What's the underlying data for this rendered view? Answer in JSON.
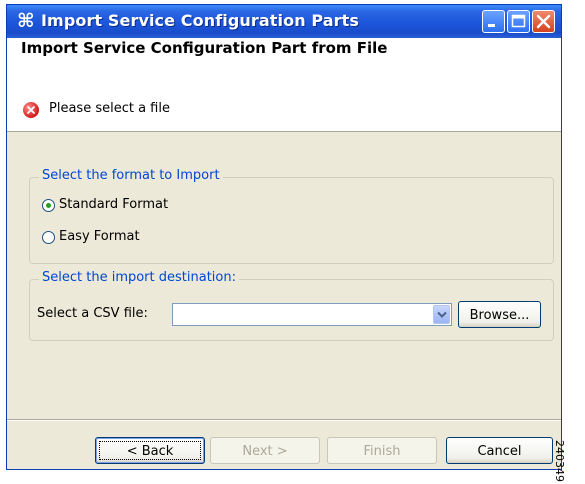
{
  "window": {
    "title": "Import Service Configuration Parts",
    "app_icon": "⌘"
  },
  "header": {
    "title": "Import Service Configuration Part from File",
    "message": "Please select a file"
  },
  "format_group": {
    "legend": "Select the format to Import",
    "options": [
      {
        "label": "Standard Format",
        "selected": true
      },
      {
        "label": "Easy Format",
        "selected": false
      }
    ]
  },
  "destination_group": {
    "legend": "Select the import destination:",
    "csv_label": "Select a CSV file:",
    "csv_value": "",
    "browse_label": "Browse..."
  },
  "buttons": {
    "back": "< Back",
    "next": "Next >",
    "finish": "Finish",
    "cancel": "Cancel"
  },
  "side_id": "240349",
  "colors": {
    "title_bar": "#2a66e3",
    "legend_text": "#0046d5",
    "error": "#d01c1c",
    "dialog_bg": "#ece9d8"
  }
}
